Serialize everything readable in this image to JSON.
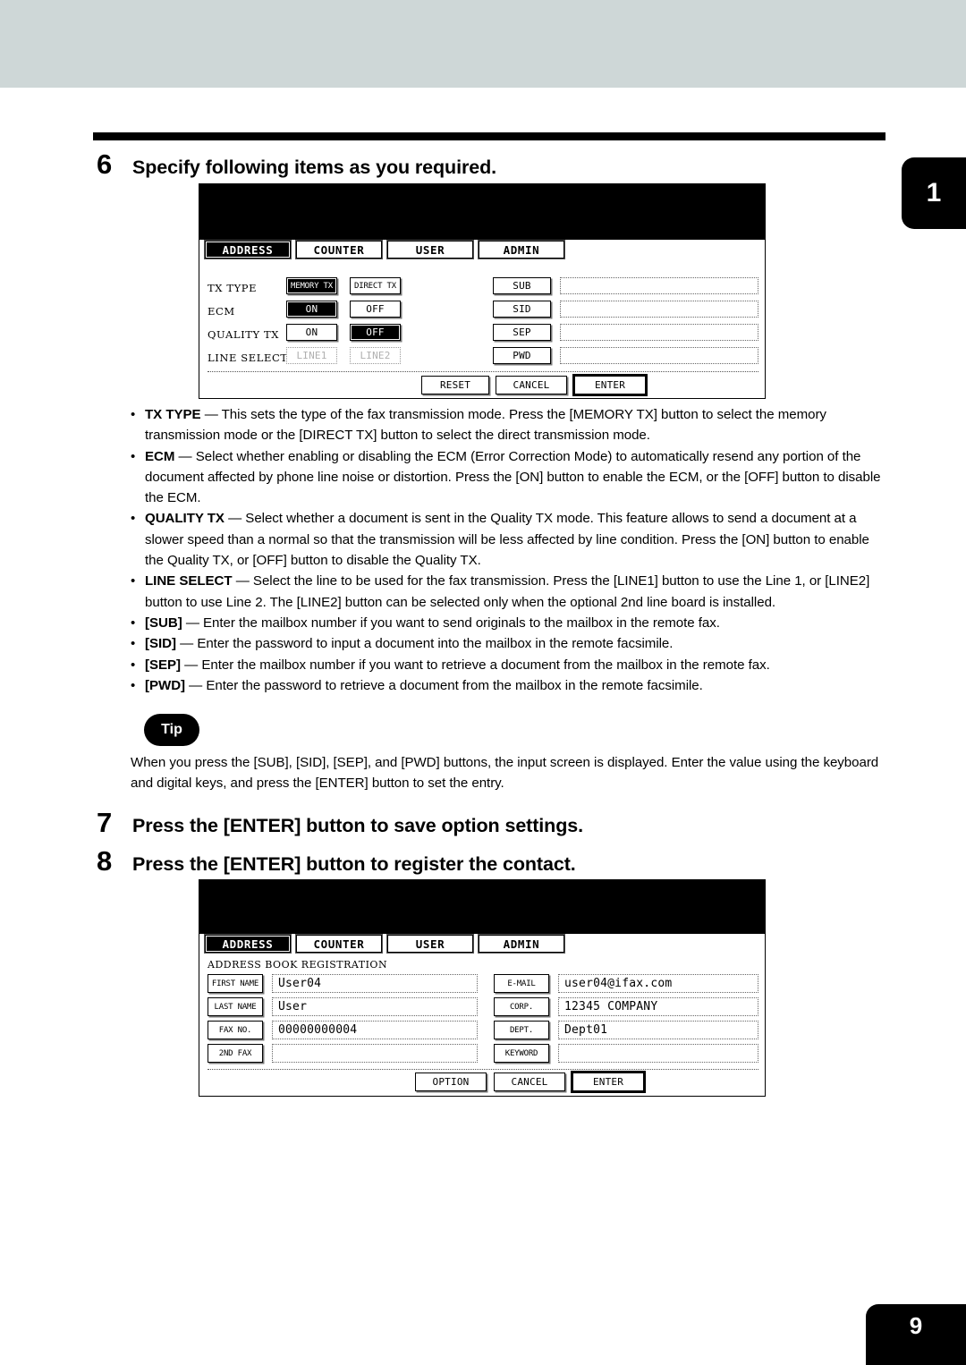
{
  "page": {
    "chapter_marker": "1",
    "page_number": "9"
  },
  "steps": [
    {
      "num": "6",
      "title": "Specify following items as you required."
    },
    {
      "num": "7",
      "title": "Press the [ENTER] button to save option settings."
    },
    {
      "num": "8",
      "title": "Press the [ENTER] button to register the contact."
    }
  ],
  "screen_options": {
    "tabs": [
      {
        "label": "ADDRESS",
        "active": true
      },
      {
        "label": "COUNTER",
        "active": false
      },
      {
        "label": "USER",
        "active": false
      },
      {
        "label": "ADMIN",
        "active": false
      }
    ],
    "rows": [
      {
        "label": "TX TYPE",
        "buttons": [
          {
            "label": "MEMORY TX",
            "state": "selected"
          },
          {
            "label": "DIRECT TX",
            "state": "normal"
          }
        ]
      },
      {
        "label": "ECM",
        "buttons": [
          {
            "label": "ON",
            "state": "selected"
          },
          {
            "label": "OFF",
            "state": "normal"
          }
        ]
      },
      {
        "label": "QUALITY TX",
        "buttons": [
          {
            "label": "ON",
            "state": "normal"
          },
          {
            "label": "OFF",
            "state": "selected"
          }
        ]
      },
      {
        "label": "LINE SELECT",
        "buttons": [
          {
            "label": "LINE1",
            "state": "disabled"
          },
          {
            "label": "LINE2",
            "state": "disabled"
          }
        ]
      }
    ],
    "mailbox_fields": [
      {
        "button": "SUB",
        "value": ""
      },
      {
        "button": "SID",
        "value": ""
      },
      {
        "button": "SEP",
        "value": ""
      },
      {
        "button": "PWD",
        "value": ""
      }
    ],
    "actions": [
      {
        "label": "RESET",
        "emphasis": false
      },
      {
        "label": "CANCEL",
        "emphasis": false
      },
      {
        "label": "ENTER",
        "emphasis": true
      }
    ]
  },
  "screen_registration": {
    "tabs": [
      {
        "label": "ADDRESS",
        "active": true
      },
      {
        "label": "COUNTER",
        "active": false
      },
      {
        "label": "USER",
        "active": false
      },
      {
        "label": "ADMIN",
        "active": false
      }
    ],
    "caption": "ADDRESS BOOK REGISTRATION",
    "left_fields": [
      {
        "button": "FIRST NAME",
        "value": "User04"
      },
      {
        "button": "LAST NAME",
        "value": "User"
      },
      {
        "button": "FAX NO.",
        "value": "00000000004"
      },
      {
        "button": "2ND FAX",
        "value": ""
      }
    ],
    "right_fields": [
      {
        "button": "E-MAIL",
        "value": "user04@ifax.com"
      },
      {
        "button": "CORP.",
        "value": "12345 COMPANY"
      },
      {
        "button": "DEPT.",
        "value": "Dept01"
      },
      {
        "button": "KEYWORD",
        "value": ""
      }
    ],
    "actions": [
      {
        "label": "OPTION",
        "emphasis": false
      },
      {
        "label": "CANCEL",
        "emphasis": false
      },
      {
        "label": "ENTER",
        "emphasis": true
      }
    ]
  },
  "bullets": [
    {
      "term": "TX TYPE",
      "dash": " — ",
      "text": "This sets the type of the fax transmission mode.  Press the [MEMORY TX] button to select the memory transmission mode or the [DIRECT TX] button to select the direct transmission mode."
    },
    {
      "term": "ECM",
      "dash": " — ",
      "text": "Select whether enabling or disabling the ECM (Error Correction Mode) to automatically resend any portion of the document affected by phone line noise or distortion.  Press the [ON] button to enable the ECM, or the [OFF] button to disable the ECM."
    },
    {
      "term": "QUALITY TX",
      "dash": " — ",
      "text": "Select whether a document is sent in the Quality TX mode. This feature allows to send a document at a slower speed than a normal so that the transmission will be less affected by line condition.  Press the [ON] button to enable the Quality TX, or [OFF] button to disable the Quality TX."
    },
    {
      "term": "LINE SELECT",
      "dash": " — ",
      "text": "Select the line to be used for the fax transmission.  Press the [LINE1] button to use the Line 1, or [LINE2] button to use Line 2.  The [LINE2] button can be selected only when the optional 2nd line board is installed."
    },
    {
      "term": "[SUB]",
      "dash": " — ",
      "text": "Enter the mailbox number if you want to send originals to the mailbox in the remote fax."
    },
    {
      "term": "[SID]",
      "dash": " — ",
      "text": "Enter the password to input a document into the mailbox in the remote facsimile."
    },
    {
      "term": "[SEP]",
      "dash": " — ",
      "text": "Enter the mailbox number if you want to retrieve a document from the mailbox in the remote fax."
    },
    {
      "term": "[PWD]",
      "dash": " — ",
      "text": "Enter the password to retrieve a document from the mailbox in the remote facsimile."
    }
  ],
  "tip": {
    "badge": "Tip",
    "text": "When you press the [SUB], [SID], [SEP], and [PWD] buttons, the input screen is displayed.  Enter the value using the keyboard and digital keys, and press the [ENTER] button to set the entry."
  },
  "colors": {
    "top_band": "#ced7d7",
    "marker": "#000000",
    "lcd_header": "#000000"
  }
}
